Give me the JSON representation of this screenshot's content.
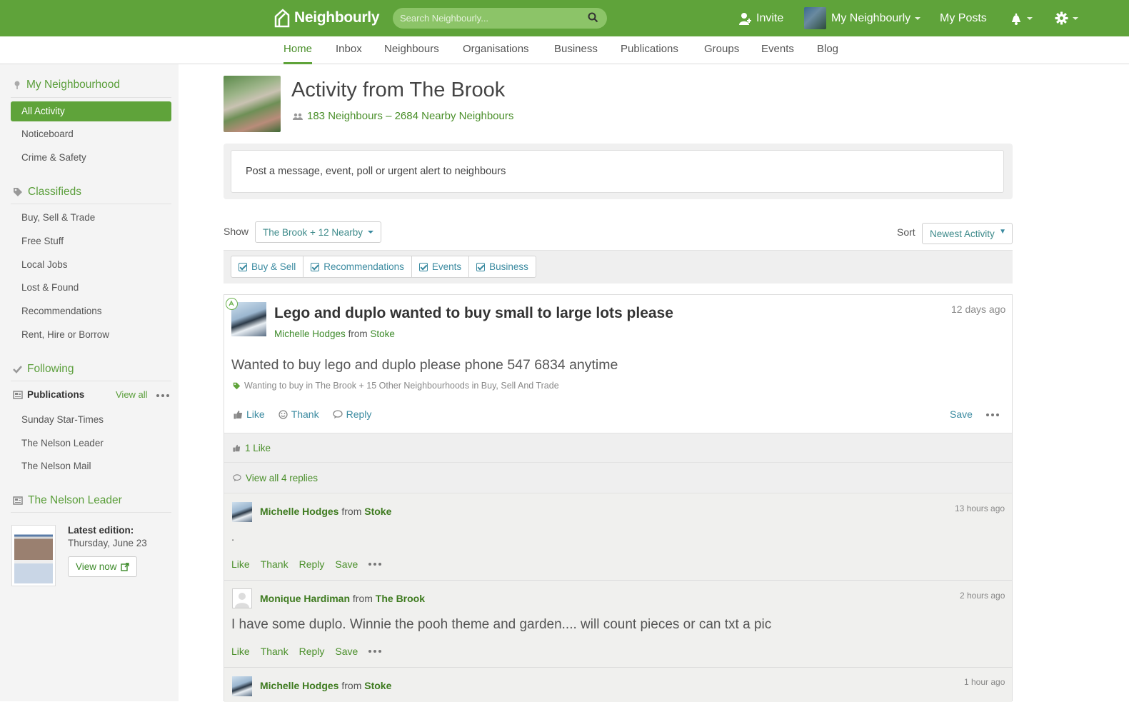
{
  "topbar": {
    "logo": "Neighbourly",
    "search_placeholder": "Search Neighbourly...",
    "invite": "Invite",
    "my_neighbourly": "My Neighbourly",
    "my_posts": "My Posts"
  },
  "nav": {
    "items": [
      "Home",
      "Inbox",
      "Neighbours",
      "Organisations",
      "Business",
      "Publications",
      "Groups",
      "Events",
      "Blog"
    ],
    "active": "Home"
  },
  "sidebar": {
    "my_neighbourhood": "My Neighbourhood",
    "hood_items": [
      "All Activity",
      "Noticeboard",
      "Crime & Safety"
    ],
    "classifieds": "Classifieds",
    "classified_items": [
      "Buy, Sell & Trade",
      "Free Stuff",
      "Local Jobs",
      "Lost & Found",
      "Recommendations",
      "Rent, Hire or Borrow"
    ],
    "following": "Following",
    "publications": "Publications",
    "view_all": "View all",
    "publication_items": [
      "Sunday Star-Times",
      "The Nelson Leader",
      "The Nelson Mail"
    ],
    "leader_title": "The Nelson Leader",
    "latest_edition": "Latest edition:",
    "edition_date": "Thursday, June 23",
    "view_now": "View now"
  },
  "main": {
    "title": "Activity from The Brook",
    "subtitle": "183 Neighbours – 2684 Nearby Neighbours",
    "post_prompt": "Post a message, event, poll or urgent alert to neighbours",
    "show_label": "Show",
    "show_value": "The Brook + 12 Nearby",
    "sort_label": "Sort",
    "sort_value": "Newest Activity",
    "filters": [
      "Buy & Sell",
      "Recommendations",
      "Events",
      "Business"
    ]
  },
  "post": {
    "title": "Lego and duplo wanted to buy small to large lots please",
    "author": "Michelle Hodges",
    "from": "from",
    "location": "Stoke",
    "time": "12 days ago",
    "body": "Wanted to buy lego and duplo please phone 547 6834 anytime",
    "tags": "Wanting to buy in The Brook + 15 Other Neighbourhoods in Buy, Sell And Trade",
    "like": "Like",
    "thank": "Thank",
    "reply": "Reply",
    "save": "Save",
    "likes_count": "1 Like",
    "view_replies": "View all 4 replies"
  },
  "replies": [
    {
      "author": "Michelle Hodges",
      "from": "from",
      "location": "Stoke",
      "time": "13 hours ago",
      "body": "."
    },
    {
      "author": "Monique Hardiman",
      "from": "from",
      "location": "The Brook",
      "time": "2 hours ago",
      "body": "I have some duplo. Winnie the pooh theme and garden.... will count pieces or can txt a pic"
    },
    {
      "author": "Michelle Hodges",
      "from": "from",
      "location": "Stoke",
      "time": "1 hour ago",
      "body": ""
    }
  ],
  "reply_actions": {
    "like": "Like",
    "thank": "Thank",
    "reply": "Reply",
    "save": "Save"
  },
  "colors": {
    "brand": "#5fa33a",
    "link": "#3a8aa0",
    "text": "#555555"
  }
}
